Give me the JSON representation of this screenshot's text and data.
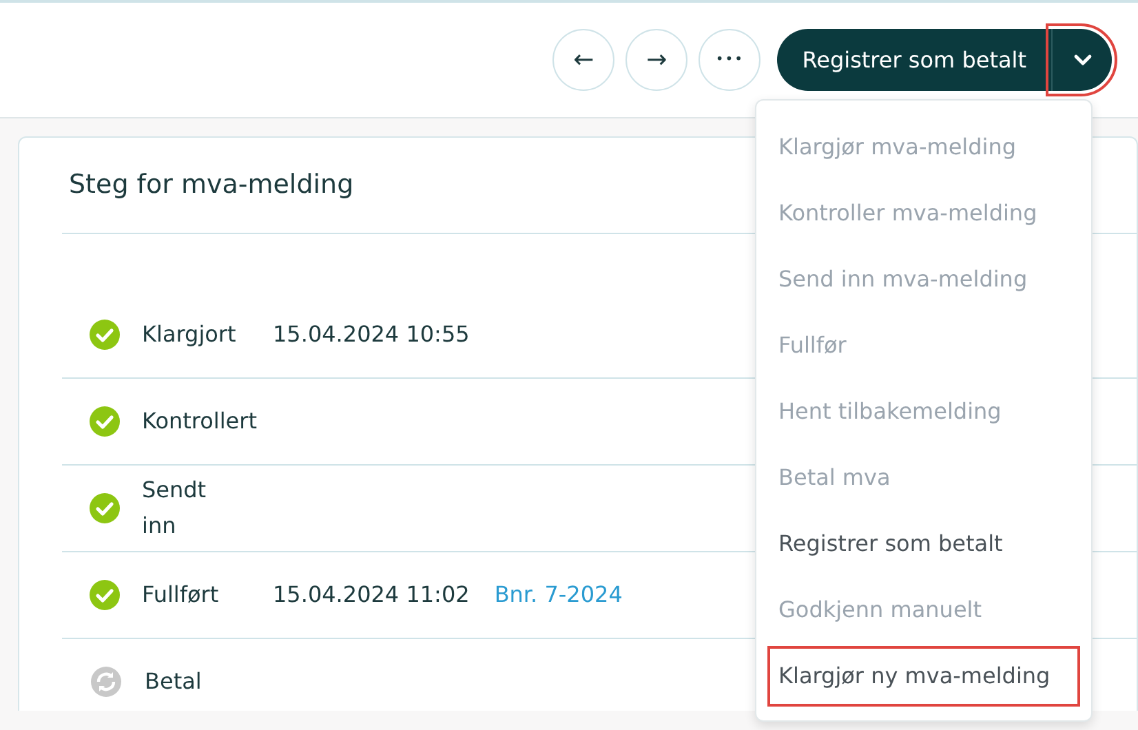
{
  "toolbar": {
    "back_button": {
      "icon": "←"
    },
    "forward_button": {
      "icon": "→"
    },
    "more_button": {
      "icon": "•••"
    },
    "primary_button": {
      "label": "Registrer som betalt"
    },
    "dropdown_toggle": {
      "expanded": true,
      "highlighted": true
    }
  },
  "card": {
    "title": "Steg for mva-melding",
    "steps": [
      {
        "label": "Klargjort",
        "done": true,
        "timestamp": "15.04.2024 10:55"
      },
      {
        "label": "Kontrollert",
        "done": true
      },
      {
        "label": "Sendt inn",
        "done": true
      },
      {
        "label": "Fullført",
        "done": true,
        "timestamp": "15.04.2024 11:02",
        "link": "Bnr. 7-2024"
      },
      {
        "label": "Betal",
        "done": false
      }
    ]
  },
  "dropdown_menu": [
    {
      "label": "Klargjør mva-melding",
      "disabled": true,
      "highlighted": false
    },
    {
      "label": "Kontroller mva-melding",
      "disabled": true,
      "highlighted": false
    },
    {
      "label": "Send inn mva-melding",
      "disabled": true,
      "highlighted": false
    },
    {
      "label": "Fullfør",
      "disabled": true,
      "highlighted": false
    },
    {
      "label": "Hent tilbakemelding",
      "disabled": true,
      "highlighted": false
    },
    {
      "label": "Betal mva",
      "disabled": true,
      "highlighted": false
    },
    {
      "label": "Registrer som betalt",
      "disabled": false,
      "highlighted": false
    },
    {
      "label": "Godkjenn manuelt",
      "disabled": true,
      "highlighted": false
    },
    {
      "label": "Klargjør ny mva-melding",
      "disabled": false,
      "highlighted": true
    }
  ]
}
